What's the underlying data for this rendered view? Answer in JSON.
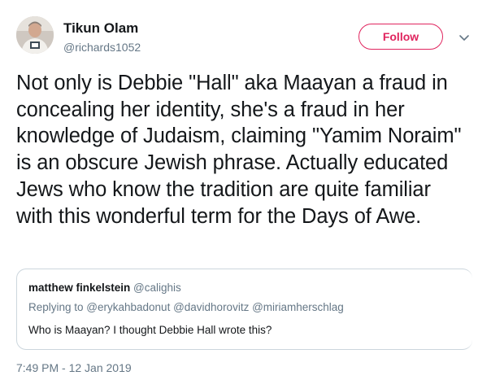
{
  "user": {
    "display_name": "Tikun Olam",
    "handle": "@richards1052"
  },
  "header": {
    "follow_label": "Follow"
  },
  "tweet": {
    "text": "Not only is Debbie \"Hall\" aka Maayan a fraud in concealing her identity, she's a fraud in her knowledge of Judaism, claiming \"Yamim Noraim\" is an obscure Jewish phrase. Actually educated Jews who know the tradition are quite familiar with this wonderful term for the Days of Awe.",
    "timestamp": "7:49 PM - 12 Jan 2019"
  },
  "quote": {
    "author_name": "matthew finkelstein",
    "author_handle": "@calighis",
    "replying_prefix": "Replying to ",
    "replying_handles": "@erykahbadonut @davidhorovitz @miriamherschlag",
    "text": "Who is Maayan? I thought Debbie Hall wrote this?"
  },
  "colors": {
    "follow_accent": "#e0245e",
    "secondary_text": "#657786",
    "primary_text": "#14171a",
    "card_border": "#ccd6dd"
  },
  "icons": {
    "caret": "chevron-down-icon",
    "avatar": "avatar"
  }
}
